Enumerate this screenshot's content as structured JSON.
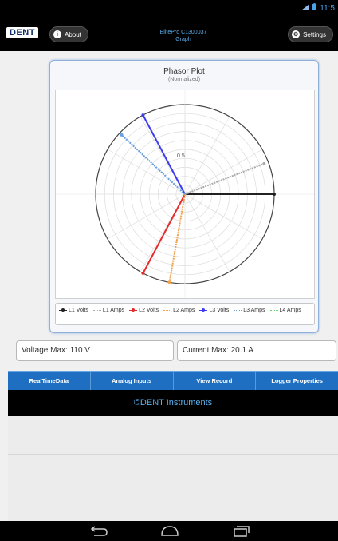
{
  "status_bar": {
    "time": "11:5",
    "signal_icon": "signal-icon",
    "battery_icon": "battery-icon"
  },
  "header": {
    "logo": "DENT",
    "about_label": "About",
    "title_line1": "ElitePro C1300037",
    "title_line2": "Graph",
    "settings_label": "Settings"
  },
  "plot": {
    "title": "Phasor Plot",
    "subtitle": "(Normalized)",
    "ring_label": "0.5"
  },
  "chart_data": {
    "type": "scatter",
    "title": "Phasor Plot",
    "subtitle": "(Normalized)",
    "rlim": [
      0,
      1
    ],
    "rticks": [
      0.5
    ],
    "grid": true,
    "legend_position": "bottom",
    "series": [
      {
        "name": "L1 Volts",
        "color": "#222222",
        "style": "solid",
        "angle_deg": 0,
        "magnitude": 1.0
      },
      {
        "name": "L1 Amps",
        "color": "#aaaaaa",
        "style": "dotted",
        "angle_deg": 21,
        "magnitude": 0.95
      },
      {
        "name": "L2 Volts",
        "color": "#e8292a",
        "style": "solid",
        "angle_deg": 242,
        "magnitude": 1.0
      },
      {
        "name": "L2 Amps",
        "color": "#f2a24a",
        "style": "dotted",
        "angle_deg": 260,
        "magnitude": 1.0
      },
      {
        "name": "L3 Volts",
        "color": "#3d3df0",
        "style": "solid",
        "angle_deg": 118,
        "magnitude": 1.0
      },
      {
        "name": "L3 Amps",
        "color": "#6a9fe0",
        "style": "dotted",
        "angle_deg": 137,
        "magnitude": 0.97
      },
      {
        "name": "L4 Amps",
        "color": "#6ad86a",
        "style": "dotted",
        "angle_deg": null,
        "magnitude": 0
      }
    ]
  },
  "info": {
    "voltage_max": "Voltage Max: 110 V",
    "current_max": "Current Max: 20.1 A"
  },
  "nav_tabs": [
    "RealTimeData",
    "Analog Inputs",
    "View Record",
    "Logger Properties"
  ],
  "brand": "©DENT Instruments"
}
